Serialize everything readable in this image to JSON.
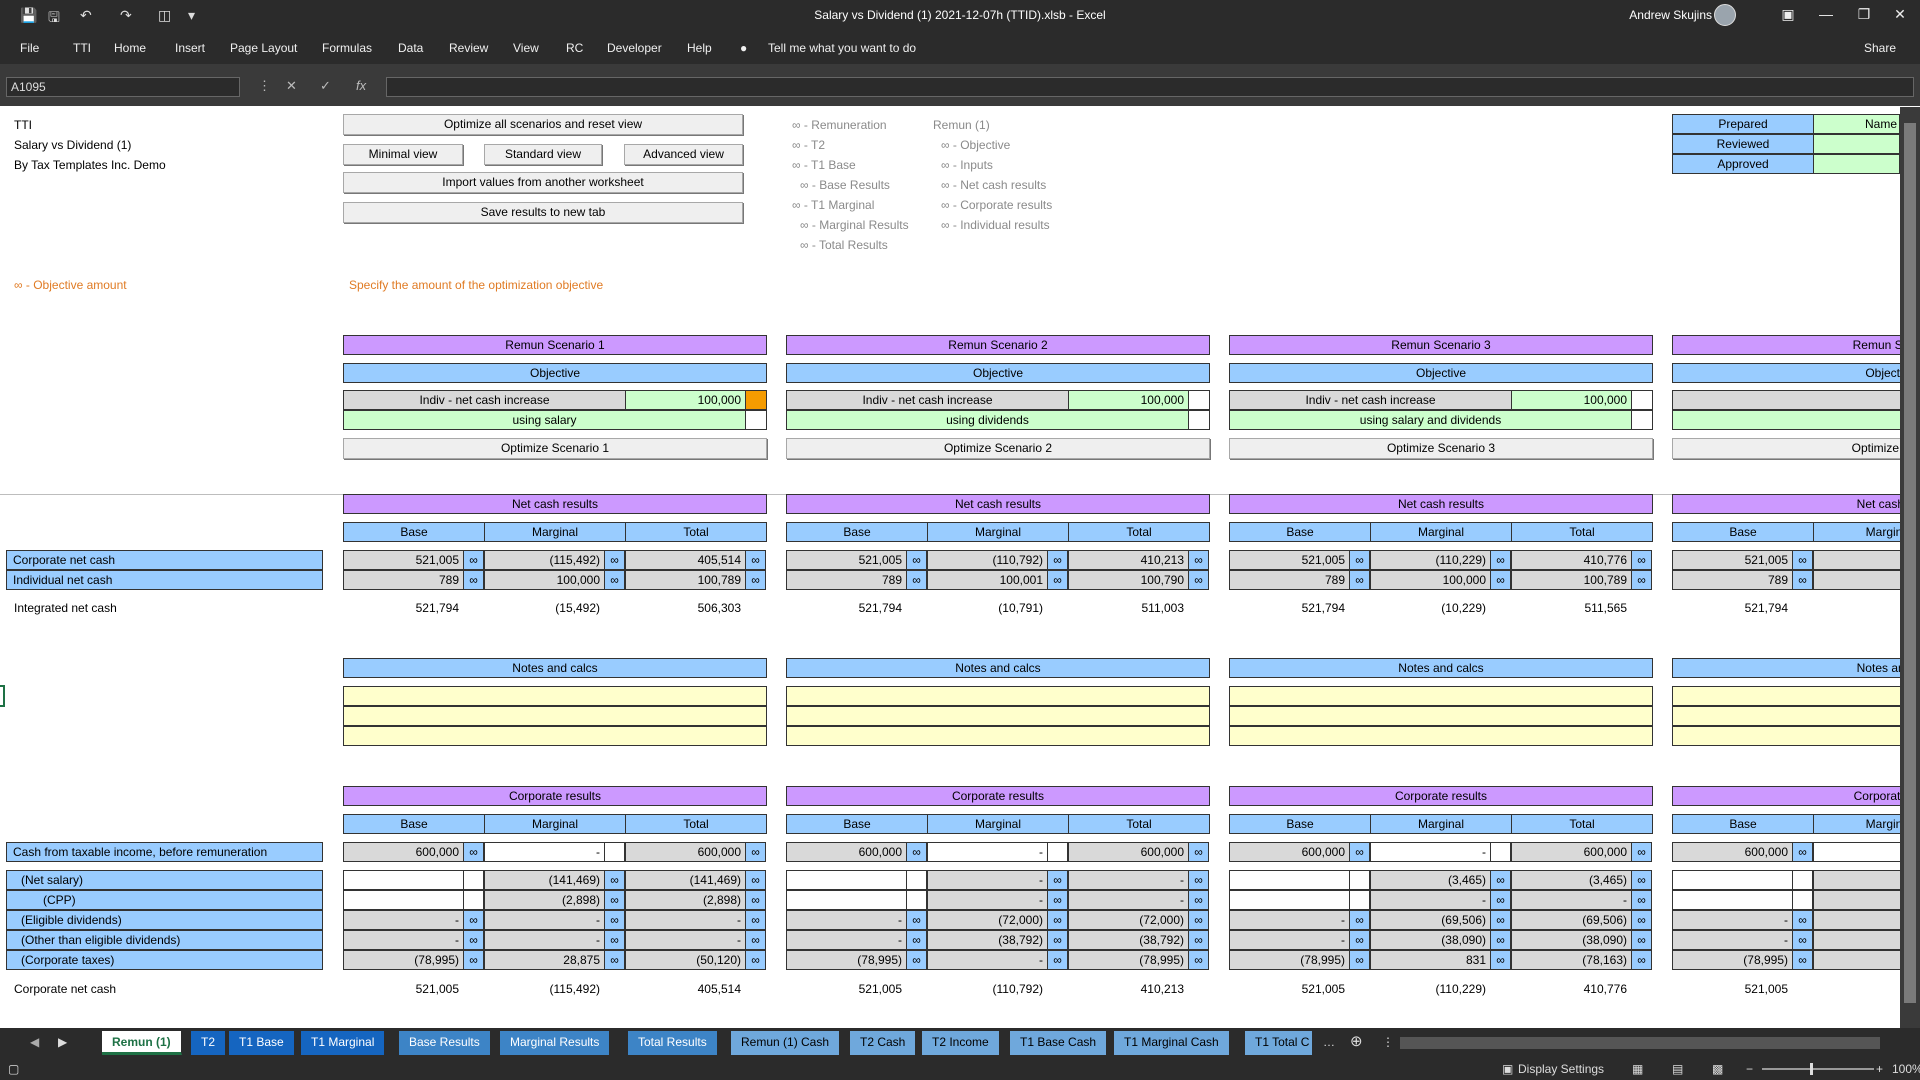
{
  "window": {
    "title": "Salary vs Dividend (1) 2021-12-07h (TTID).xlsb  -  Excel",
    "user": "Andrew Skujins"
  },
  "ribbon": {
    "tabs": [
      "File",
      "TTI",
      "Home",
      "Insert",
      "Page Layout",
      "Formulas",
      "Data",
      "Review",
      "View",
      "RC",
      "Developer",
      "Help"
    ],
    "tell_me": "Tell me what you want to do",
    "share": "Share"
  },
  "formula_bar": {
    "name_box": "A1095",
    "fx": "fx",
    "formula": ""
  },
  "sheet": {
    "header": {
      "line1": "TTI",
      "line2": "Salary vs Dividend (1)",
      "line3": "By Tax Templates Inc. Demo"
    },
    "buttons": {
      "optimize_all": "Optimize all scenarios and reset view",
      "minimal": "Minimal view",
      "standard": "Standard view",
      "advanced": "Advanced view",
      "import": "Import values from another worksheet",
      "save": "Save results to new tab"
    },
    "nav_left": [
      "∞ - Remuneration",
      "∞ - T2",
      "∞ - T1 Base",
      "∞ - Base Results",
      "∞ - T1 Marginal",
      "∞ - Marginal Results",
      "∞ - Total Results"
    ],
    "nav_right": [
      "Remun (1)",
      "∞ - Objective",
      "∞ - Inputs",
      "∞ - Net cash results",
      "∞ - Corporate results",
      "∞ - Individual results"
    ],
    "signoff": {
      "prepared": "Prepared",
      "reviewed": "Reviewed",
      "approved": "Approved",
      "name": "Name"
    },
    "objective_amount": "∞ - Objective amount",
    "objective_hint": "Specify the amount of the optimization objective",
    "scenarios": [
      {
        "title": "Remun Scenario 1",
        "objective": "Objective",
        "obj_label": "Indiv - net cash increase",
        "obj_value": "100,000",
        "method": "using salary",
        "optimize": "Optimize Scenario 1"
      },
      {
        "title": "Remun Scenario 2",
        "objective": "Objective",
        "obj_label": "Indiv - net cash increase",
        "obj_value": "100,000",
        "method": "using dividends",
        "optimize": "Optimize Scenario 2"
      },
      {
        "title": "Remun Scenario 3",
        "objective": "Objective",
        "obj_label": "Indiv - net cash increase",
        "obj_value": "100,000",
        "method": "using salary and dividends",
        "optimize": "Optimize Scenario 3"
      },
      {
        "title": "Remun Sce",
        "objective": "Objecti",
        "obj_label": "",
        "obj_value": "",
        "method": "",
        "optimize": "Optimize Sc"
      }
    ],
    "net_cash": {
      "section": "Net cash results",
      "cols": [
        "Base",
        "Marginal",
        "Total"
      ],
      "row_labels": [
        "Corporate net cash",
        "Individual net cash"
      ],
      "integrated_label": "Integrated net cash",
      "blocks": [
        {
          "corp": [
            "521,005",
            "(115,492)",
            "405,514"
          ],
          "indiv": [
            "789",
            "100,000",
            "100,789"
          ],
          "integrated": [
            "521,794",
            "(15,492)",
            "506,303"
          ]
        },
        {
          "corp": [
            "521,005",
            "(110,792)",
            "410,213"
          ],
          "indiv": [
            "789",
            "100,001",
            "100,790"
          ],
          "integrated": [
            "521,794",
            "(10,791)",
            "511,003"
          ]
        },
        {
          "corp": [
            "521,005",
            "(110,229)",
            "410,776"
          ],
          "indiv": [
            "789",
            "100,000",
            "100,789"
          ],
          "integrated": [
            "521,794",
            "(10,229)",
            "511,565"
          ]
        },
        {
          "corp": [
            "521,005",
            "",
            ""
          ],
          "indiv": [
            "789",
            "",
            ""
          ],
          "integrated": [
            "521,794",
            "",
            ""
          ]
        }
      ],
      "partial_cols": [
        "Base",
        "Margin"
      ],
      "partial_section": "Net cash r"
    },
    "notes": {
      "section": "Notes and calcs",
      "partial": "Notes and"
    },
    "corporate": {
      "section": "Corporate results",
      "partial_section": "Corporate r",
      "row_labels": [
        "Cash from taxable income, before remuneration",
        "(Net salary)",
        "(CPP)",
        "(Eligible dividends)",
        "(Other than eligible dividends)",
        "(Corporate taxes)"
      ],
      "net_label": "Corporate net cash",
      "blocks": [
        {
          "cash": [
            "600,000",
            "-",
            "600,000"
          ],
          "salary": [
            "",
            "(141,469)",
            "(141,469)"
          ],
          "cpp": [
            "",
            "(2,898)",
            "(2,898)"
          ],
          "elig": [
            "-",
            "-",
            "-"
          ],
          "other": [
            "-",
            "-",
            "-"
          ],
          "tax": [
            "(78,995)",
            "28,875",
            "(50,120)"
          ],
          "net": [
            "521,005",
            "(115,492)",
            "405,514"
          ]
        },
        {
          "cash": [
            "600,000",
            "-",
            "600,000"
          ],
          "salary": [
            "",
            "-",
            "-"
          ],
          "cpp": [
            "",
            "-",
            "-"
          ],
          "elig": [
            "-",
            "(72,000)",
            "(72,000)"
          ],
          "other": [
            "-",
            "(38,792)",
            "(38,792)"
          ],
          "tax": [
            "(78,995)",
            "-",
            "(78,995)"
          ],
          "net": [
            "521,005",
            "(110,792)",
            "410,213"
          ]
        },
        {
          "cash": [
            "600,000",
            "-",
            "600,000"
          ],
          "salary": [
            "",
            "(3,465)",
            "(3,465)"
          ],
          "cpp": [
            "",
            "-",
            "-"
          ],
          "elig": [
            "-",
            "(69,506)",
            "(69,506)"
          ],
          "other": [
            "-",
            "(38,090)",
            "(38,090)"
          ],
          "tax": [
            "(78,995)",
            "831",
            "(78,163)"
          ],
          "net": [
            "521,005",
            "(110,229)",
            "410,776"
          ]
        },
        {
          "cash": [
            "600,000",
            "",
            ""
          ],
          "salary": [
            "",
            "",
            ""
          ],
          "cpp": [
            "",
            "",
            ""
          ],
          "elig": [
            "-",
            "",
            ""
          ],
          "other": [
            "-",
            "",
            ""
          ],
          "tax": [
            "(78,995)",
            "",
            ""
          ],
          "net": [
            "521,005",
            "",
            ""
          ]
        }
      ]
    }
  },
  "sheet_tabs": [
    "Remun (1)",
    "T2",
    "T1 Base",
    "T1 Marginal",
    "Base Results",
    "Marginal Results",
    "Total Results",
    "Remun (1) Cash",
    "T2 Cash",
    "T2 Income",
    "T1 Base Cash",
    "T1 Marginal Cash",
    "T1 Total C"
  ],
  "status": {
    "display_settings": "Display Settings",
    "zoom": "100%"
  }
}
